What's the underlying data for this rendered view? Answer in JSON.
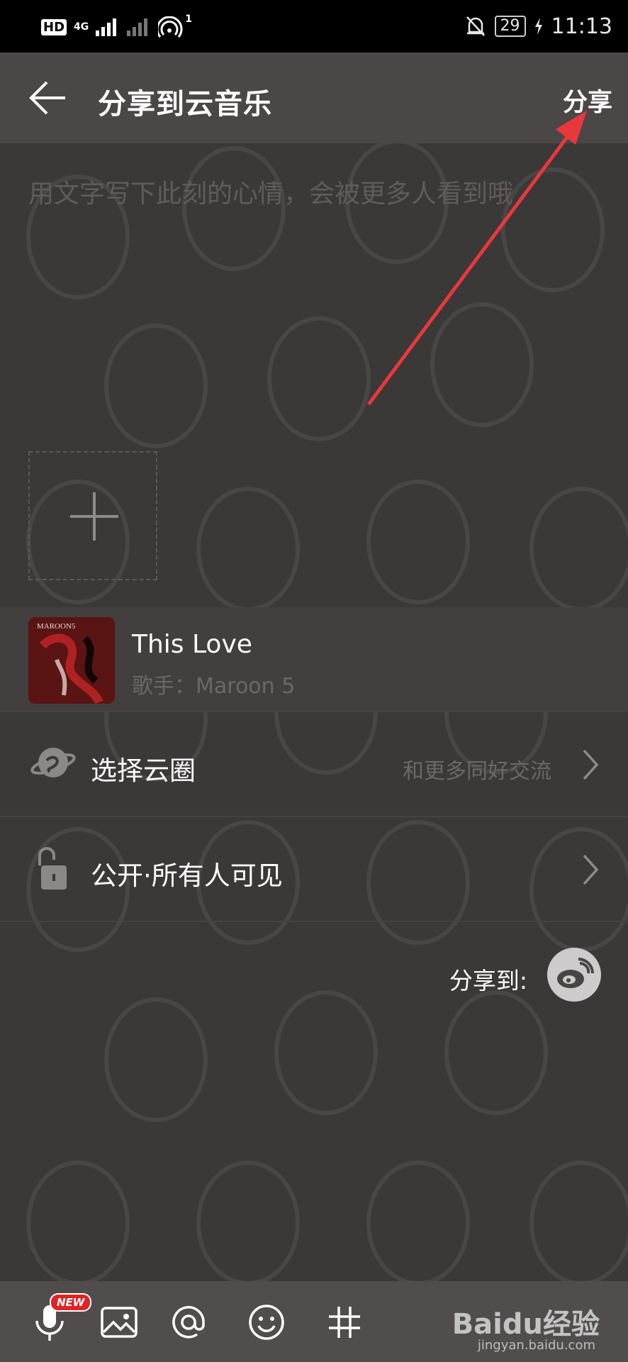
{
  "status_bar": {
    "hd": "HD",
    "network": "4G",
    "hotspot_count": "1",
    "battery": "29",
    "time": "11:13"
  },
  "header": {
    "title": "分享到云音乐",
    "share_label": "分享"
  },
  "mood": {
    "placeholder": "用文字写下此刻的心情，会被更多人看到哦"
  },
  "song": {
    "title": "This Love",
    "artist": "歌手：Maroon 5",
    "album_text": "MAROON5"
  },
  "circle": {
    "label": "选择云圈",
    "hint": "和更多同好交流"
  },
  "privacy": {
    "label": "公开·所有人可见"
  },
  "share_to": {
    "label": "分享到:"
  },
  "toolbar": {
    "new_badge": "NEW"
  },
  "watermark": {
    "brand": "Baidu经验",
    "url": "jingyan.baidu.com"
  },
  "colors": {
    "background": "#3b3838",
    "header": "#4c4747",
    "annotation_arrow": "#e8383d",
    "badge": "#e02323"
  }
}
